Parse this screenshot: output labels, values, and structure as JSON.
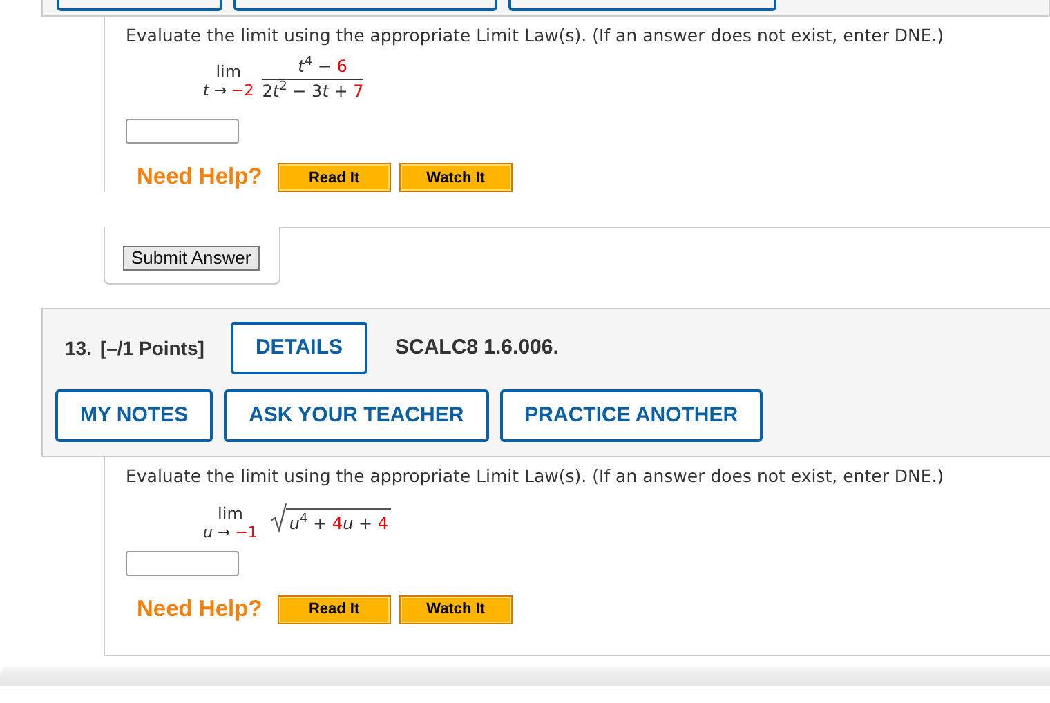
{
  "previous_question": {
    "cut_buttons": [
      {
        "kind": "outlined"
      },
      {
        "kind": "outlined"
      },
      {
        "kind": "outlined"
      }
    ],
    "body": {
      "prompt": "Evaluate the limit using the appropriate Limit Law(s). (If an answer does not exist, enter DNE.)",
      "limit": {
        "kind": "fraction",
        "operator": "lim",
        "approach": [
          {
            "text": "*t* → ",
            "highlighted": false
          },
          {
            "text": "−2",
            "highlighted": true
          }
        ],
        "numerator": [
          {
            "text": "*t*$^{4}$ − ",
            "highlighted": false
          },
          {
            "text": "6",
            "highlighted": true
          }
        ],
        "denominator": [
          {
            "text": "2",
            "highlighted": false
          },
          {
            "text": "*t*$^{2}$ − 3",
            "highlighted": false
          },
          {
            "text": "*t* + ",
            "highlighted": false
          },
          {
            "text": "7",
            "highlighted": true
          }
        ]
      },
      "has_answer_field": true,
      "help": {
        "label": "Need Help?",
        "buttons": [
          "Read It",
          "Watch It"
        ]
      },
      "submit_button": "Submit Answer"
    }
  },
  "question": {
    "header": {
      "number": "13.",
      "points": "[–/1 Points]",
      "details_button": "DETAILS",
      "code": "SCALC8 1.6.006.",
      "buttons": [
        "MY NOTES",
        "ASK YOUR TEACHER",
        "PRACTICE ANOTHER"
      ]
    },
    "body": {
      "prompt": "Evaluate the limit using the appropriate Limit Law(s). (If an answer does not exist, enter DNE.)",
      "limit": {
        "kind": "sqrt",
        "operator": "lim",
        "approach": [
          {
            "text": "*u* → ",
            "highlighted": false
          },
          {
            "text": "−1",
            "highlighted": true
          }
        ],
        "radicand": [
          {
            "text": "*u*$^{4}$ + ",
            "highlighted": false
          },
          {
            "text": "4",
            "highlighted": true
          },
          {
            "text": "*u* + ",
            "highlighted": false
          },
          {
            "text": "4",
            "highlighted": true
          }
        ]
      },
      "has_answer_field": true,
      "help": {
        "label": "Need Help?",
        "buttons": [
          "Read It",
          "Watch It"
        ]
      }
    }
  }
}
